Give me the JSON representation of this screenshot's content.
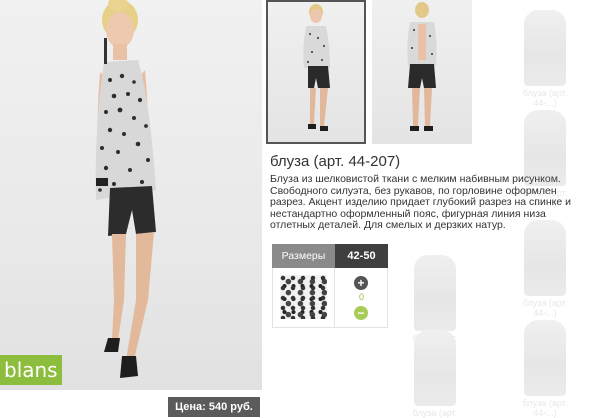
{
  "brand": "blans",
  "price_label": "Цена: 540 руб.",
  "product": {
    "title": "блуза (арт. 44-207)",
    "description": "Блуза из шелковистой ткани с мелким набивным рисунком. Свободного силуэта, без рукавов, по горловине оформлен разрез. Акцент изделию придает глубокий разрез на спинке и нестандартно  оформленный пояс, фигурная линия низа отлетных деталей. Для смелых и дерзких натур."
  },
  "sizes": {
    "header_label": "Размеры",
    "range": "42-50",
    "quantity": "0",
    "plus_symbol": "+",
    "minus_symbol": "−"
  },
  "colors": {
    "accent_green": "#8dbd3d",
    "price_bg": "#5b5b5b",
    "size_header_label_bg": "#8a8a8a",
    "size_header_value_bg": "#3f3f3f"
  },
  "faded_items": [
    {
      "caption": "блуза\n(арт. 44-...)"
    },
    {
      "caption": "блуза\n(арт. 44-...)"
    },
    {
      "caption": "блуза\n(арт. 44-...)"
    },
    {
      "caption": "блуза\n(арт. 44-...)"
    },
    {
      "caption": "блуза\n(арт. 44-...)"
    },
    {
      "caption": "блуза\n(арт. 44-...)"
    }
  ]
}
